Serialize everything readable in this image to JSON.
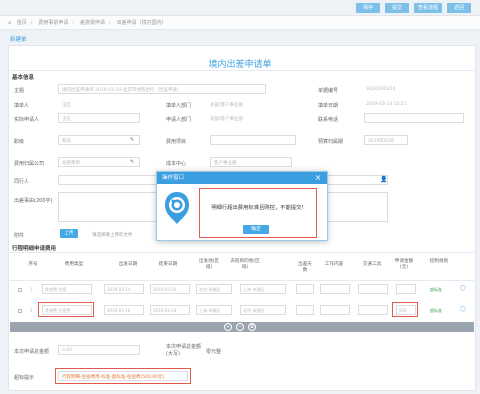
{
  "toolbar": {
    "buttons": [
      "保存",
      "提交",
      "查看流程",
      "返回"
    ]
  },
  "breadcrumb": [
    "首页",
    "费用事前申请",
    "差旅费申请",
    "出差申请（境内国内）"
  ],
  "tab_label": "新建单",
  "form_title": "境内出差申请单",
  "basic_info": {
    "section_label": "基本信息",
    "subject_label": "主题",
    "subject_value": "境内出差申请单-2019-03-14-北京市地铁出行（出差申请）",
    "doc_no_label": "单据编号",
    "doc_no_value": "SQ2019031X",
    "applicant_label": "填单人",
    "applicant_value": "王红",
    "applicant_dept_label": "填单人部门",
    "applicant_dept_value": "总部/客户事业部",
    "fill_date_label": "填单日期",
    "fill_date_value": "2019-03-14 10:21",
    "actual_applicant_label": "实际申请人",
    "actual_applicant_value": "王红",
    "app_dept_label": "申请人部门",
    "app_dept_value": "总部/客户事业部",
    "phone_label": "联系电话",
    "phone_value": "",
    "position_label": "职级",
    "position_value": "职员",
    "project_label": "费用项目",
    "project_value": "",
    "budget_period_label": "预算归属期",
    "budget_period_value": "2019年03月",
    "company_label": "费用归属公司",
    "company_value": "总部费用",
    "cost_center_label": "成本中心",
    "cost_center_value": "客户事业部",
    "companion_label": "同行人",
    "reason_label": "出差事由(200字)",
    "attachment_label": "附件",
    "upload_label": "上传",
    "attachment_hint": "请选择要上传的文件"
  },
  "itinerary": {
    "section_label": "行程明细申请费用",
    "headers": [
      "序号",
      "费用类型",
      "出发日期",
      "结束日期",
      "出发地(区域)",
      "去程目的地(区域)",
      "出差天数",
      "工作内容",
      "交通工具",
      "申请金额(元)",
      "控制规则"
    ],
    "rows": [
      {
        "no": "1",
        "type": "差旅费-住宿",
        "start": "2019-03-14",
        "end": "2019-03-16",
        "from": "北京-市辖区",
        "to": "上海-市辖区",
        "days": "2",
        "work": "",
        "transport": "",
        "amount": "",
        "rule": "超标准"
      },
      {
        "no": "2",
        "type": "差旅费-住宿费",
        "start": "2019-03-16",
        "end": "2019-03-18",
        "from": "上海-市辖区",
        "to": "北京-市辖区",
        "days": "2",
        "work": "",
        "transport": "",
        "amount": "500",
        "rule": "超标准"
      }
    ]
  },
  "total_label": "本次申请总金额",
  "total_value": "0.00",
  "total_upper_label": "本次申请总金额(大写)",
  "total_upper_value": "零元整",
  "warning_label": "超标提示",
  "warning_value": "行程明细-住宿费用-标准-超标准-住宿费(500.00元)",
  "dialog": {
    "title": "操作窗口",
    "message": "明细行超出费用标准且刚控，不能提交！",
    "ok_label": "确定",
    "close": "×"
  }
}
